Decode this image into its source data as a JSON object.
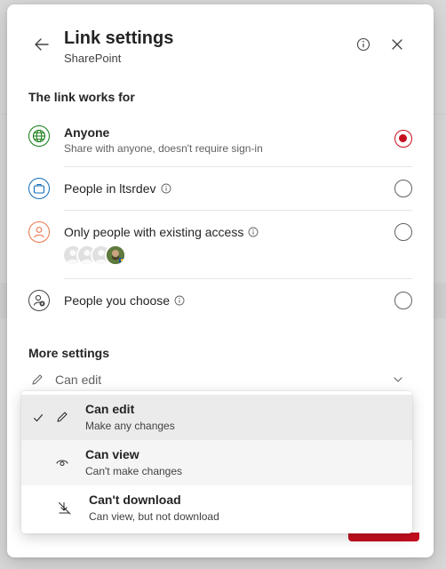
{
  "header": {
    "title": "Link settings",
    "subtitle": "SharePoint"
  },
  "link_works_for": {
    "heading": "The link works for",
    "options": [
      {
        "label": "Anyone",
        "description": "Share with anyone, doesn't require sign-in",
        "icon": "globe-icon",
        "selected": true
      },
      {
        "label": "People in ltsrdev",
        "icon": "briefcase-icon",
        "selected": false
      },
      {
        "label": "Only people with existing access",
        "icon": "person-icon",
        "selected": false
      },
      {
        "label": "People you choose",
        "icon": "person-lock-icon",
        "selected": false
      }
    ]
  },
  "more_settings": {
    "heading": "More settings",
    "permission_value": "Can edit"
  },
  "permission_menu": {
    "items": [
      {
        "label": "Can edit",
        "description": "Make any changes",
        "checked": true
      },
      {
        "label": "Can view",
        "description": "Can't make changes",
        "checked": false
      },
      {
        "label": "Can't download",
        "description": "Can view, but not download",
        "checked": false
      }
    ]
  },
  "colors": {
    "accent": "#c50f1f",
    "globe": "#107c10",
    "briefcase": "#0f6cbd",
    "person": "#e97548",
    "neutral_icon": "#424242"
  }
}
